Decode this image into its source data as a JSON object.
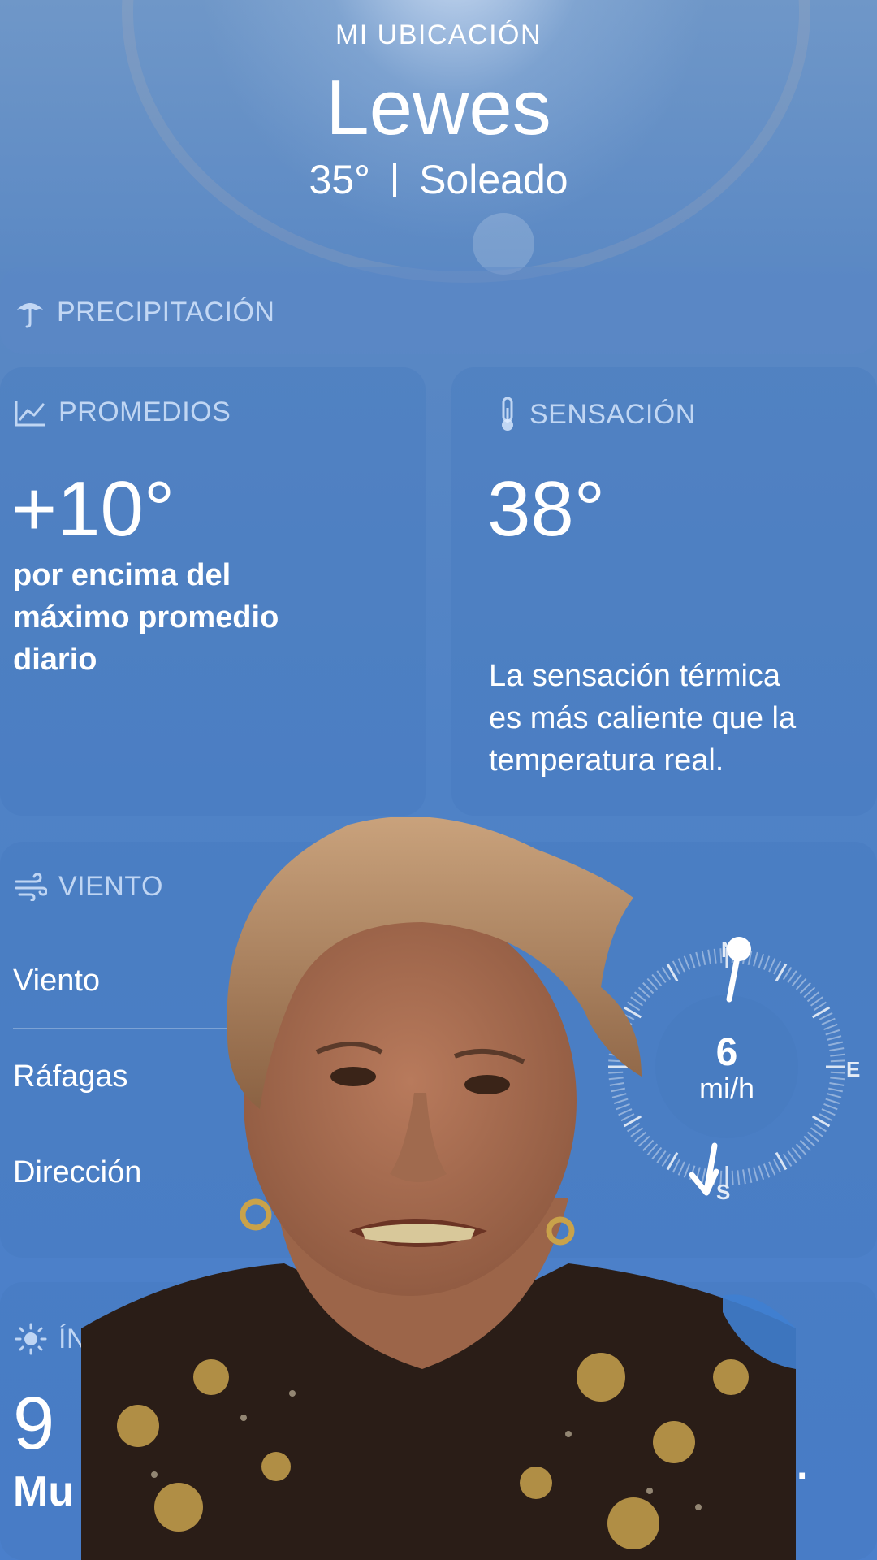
{
  "header": {
    "location_label": "MI UBICACIÓN",
    "city": "Lewes",
    "temperature": "35°",
    "condition": "Soleado"
  },
  "precipitation": {
    "title": "PRECIPITACIÓN"
  },
  "averages": {
    "title": "PROMEDIOS",
    "value": "+10°",
    "description_lines": [
      "por encima del",
      "máximo promedio",
      "diario"
    ]
  },
  "feels_like": {
    "title": "SENSACIÓN",
    "value": "38°",
    "description_lines": [
      "La sensación térmica",
      "es más caliente que la",
      "temperatura real."
    ]
  },
  "wind": {
    "title": "VIENTO",
    "rows": [
      "Viento",
      "Ráfagas",
      "Dirección"
    ],
    "speed": "6",
    "unit": "mi/h",
    "compass": {
      "n": "N",
      "e": "E",
      "s": "S"
    }
  },
  "uv": {
    "title_partial": "ÍNDI",
    "value_partial": "9",
    "label_partial": "Mu",
    "trailing": "."
  },
  "icons": [
    "umbrella-icon",
    "chart-icon",
    "thermometer-icon",
    "wind-icon",
    "sun-icon",
    "arrow-down-icon"
  ],
  "colors": {
    "background": "#4f82c6",
    "card": "#4678be",
    "text_muted": "#dcebff"
  }
}
